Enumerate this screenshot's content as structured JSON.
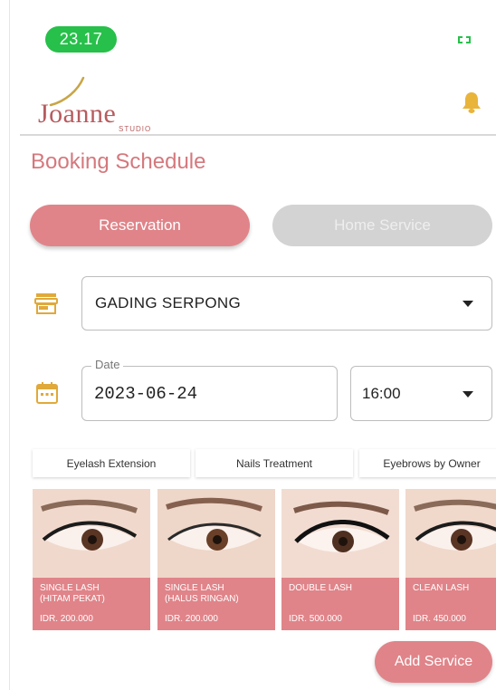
{
  "status_bar": {
    "time": "23.17"
  },
  "brand": {
    "name": "Joanne",
    "sub": "STUDIO"
  },
  "page": {
    "title": "Booking Schedule"
  },
  "tabs": [
    {
      "label": "Reservation",
      "active": true
    },
    {
      "label": "Home Service",
      "active": false
    }
  ],
  "form": {
    "branch": {
      "value": "GADING SERPONG",
      "icon": "store-icon"
    },
    "date": {
      "label": "Date",
      "value": "2023-06-24",
      "icon": "calendar-icon"
    },
    "time": {
      "value": "16:00"
    }
  },
  "categories": [
    {
      "label": "Eyelash Extension"
    },
    {
      "label": "Nails Treatment"
    },
    {
      "label": "Eyebrows by Owner"
    }
  ],
  "services": [
    {
      "name_line1": "SINGLE LASH",
      "name_line2": "(HITAM PEKAT)",
      "price": "IDR. 200.000",
      "selected": true
    },
    {
      "name_line1": "SINGLE LASH",
      "name_line2": "(HALUS RINGAN)",
      "price": "IDR. 200.000",
      "selected": false
    },
    {
      "name_line1": "DOUBLE LASH",
      "name_line2": "",
      "price": "IDR. 500.000",
      "selected": false
    },
    {
      "name_line1": "CLEAN LASH",
      "name_line2": "",
      "price": "IDR. 450.000",
      "selected": false
    }
  ],
  "actions": {
    "add_service": "Add Service"
  },
  "colors": {
    "brand": "#e08489",
    "title": "#d5787d",
    "accent": "#e9c873",
    "status": "#27c04a"
  }
}
